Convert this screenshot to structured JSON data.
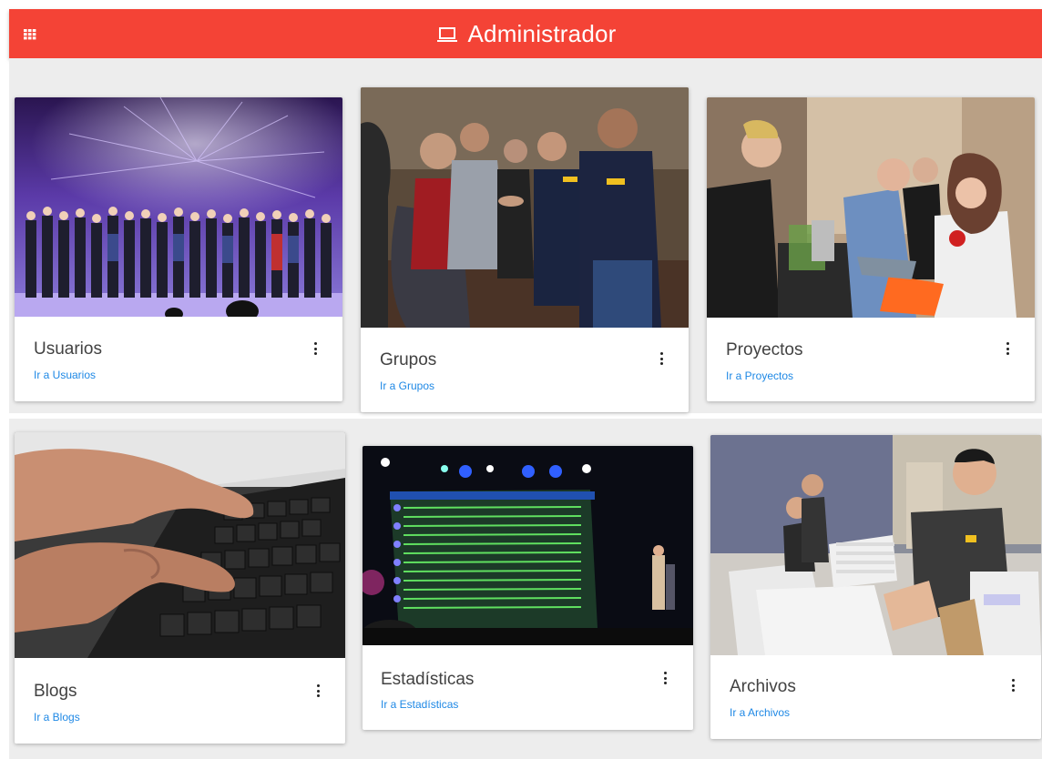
{
  "appbar": {
    "title": "Administrador",
    "apps_icon": "apps-grid-icon",
    "title_icon": "laptop-icon",
    "color": "#f44336"
  },
  "cards": [
    {
      "title": "Usuarios",
      "link": "Ir a Usuarios",
      "menu_icon": "more-vert-icon"
    },
    {
      "title": "Grupos",
      "link": "Ir a Grupos",
      "menu_icon": "more-vert-icon"
    },
    {
      "title": "Proyectos",
      "link": "Ir a Proyectos",
      "menu_icon": "more-vert-icon"
    },
    {
      "title": "Blogs",
      "link": "Ir a Blogs",
      "menu_icon": "more-vert-icon"
    },
    {
      "title": "Estadísticas",
      "link": "Ir a Estadísticas",
      "menu_icon": "more-vert-icon"
    },
    {
      "title": "Archivos",
      "link": "Ir a Archivos",
      "menu_icon": "more-vert-icon"
    }
  ],
  "colors": {
    "link": "#1e88e5",
    "background": "#ededed"
  }
}
